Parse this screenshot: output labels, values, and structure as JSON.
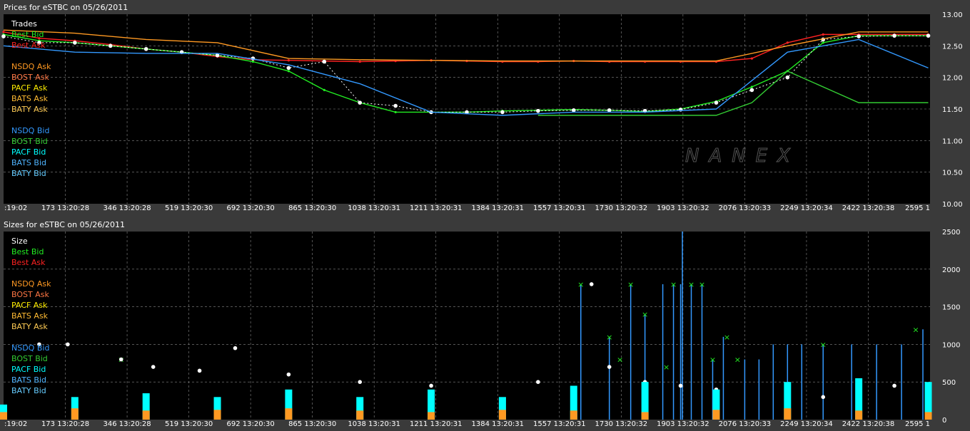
{
  "colors": {
    "trades": "#ffffff",
    "best_bid": "#22ee22",
    "best_ask": "#ff2222",
    "nsdq_ask": "#ff9922",
    "bost_ask": "#ff7744",
    "pacf_ask": "#ffee00",
    "bats_ask": "#ffbb33",
    "baty_ask": "#ffcc55",
    "nsdq_bid": "#3399ff",
    "bost_bid": "#33cc33",
    "pacf_bid": "#00ffff",
    "bats_bid": "#4fb4ff",
    "baty_bid": "#66ccff",
    "grid": "#888888",
    "plot_bg": "#000000",
    "frame_bg": "#3a3a3a"
  },
  "chart_data": [
    {
      "type": "line",
      "title": "Prices for  eSTBC  on  05/26/2011",
      "watermark": "NANEX",
      "ylim": [
        10.0,
        13.0
      ],
      "y_ticks": [
        "13.00",
        "12.50",
        "12.00",
        "11.50",
        "11.00",
        "10.50",
        "10.00"
      ],
      "x_tick_labels": [
        ":19:02",
        "173 13:20:28",
        "346 13:20:28",
        "519 13:20:30",
        "692 13:20:30",
        "865 13:20:30",
        "1038 13:20:31",
        "1211 13:20:31",
        "1384 13:20:31",
        "1557 13:20:31",
        "1730 13:20:32",
        "1903 13:20:32",
        "2076 13:20:33",
        "2249 13:20:34",
        "2422 13:20:38",
        "2595 1"
      ],
      "xlim": [
        0,
        2600
      ],
      "legend_position": "top-left",
      "legend": [
        {
          "label": "Trades",
          "color_key": "trades"
        },
        {
          "label": "Best Bid",
          "color_key": "best_bid"
        },
        {
          "label": "Best Ask",
          "color_key": "best_ask"
        },
        {
          "label": "NSDQ Ask",
          "color_key": "nsdq_ask"
        },
        {
          "label": "BOST Ask",
          "color_key": "bost_ask"
        },
        {
          "label": "PACF Ask",
          "color_key": "pacf_ask"
        },
        {
          "label": "BATS Ask",
          "color_key": "bats_ask"
        },
        {
          "label": "BATY Ask",
          "color_key": "baty_ask"
        },
        {
          "label": "NSDQ Bid",
          "color_key": "nsdq_bid"
        },
        {
          "label": "BOST Bid",
          "color_key": "bost_bid"
        },
        {
          "label": "PACF Bid",
          "color_key": "pacf_bid"
        },
        {
          "label": "BATS Bid",
          "color_key": "bats_bid"
        },
        {
          "label": "BATY Bid",
          "color_key": "baty_bid"
        }
      ],
      "series": [
        {
          "name": "Best Ask",
          "color_key": "best_ask",
          "x": [
            0,
            100,
            200,
            300,
            400,
            500,
            600,
            700,
            800,
            900,
            1000,
            1100,
            1200,
            1300,
            1400,
            1500,
            1600,
            1700,
            1800,
            1900,
            2000,
            2100,
            2200,
            2300,
            2400,
            2500,
            2595
          ],
          "y": [
            12.72,
            12.62,
            12.58,
            12.52,
            12.45,
            12.4,
            12.33,
            12.28,
            12.27,
            12.26,
            12.25,
            12.26,
            12.27,
            12.26,
            12.25,
            12.25,
            12.26,
            12.25,
            12.25,
            12.25,
            12.25,
            12.3,
            12.55,
            12.68,
            12.68,
            12.68,
            12.68
          ]
        },
        {
          "name": "Best Bid",
          "color_key": "best_bid",
          "x": [
            0,
            100,
            200,
            300,
            400,
            500,
            600,
            700,
            800,
            900,
            1000,
            1100,
            1200,
            1300,
            1400,
            1500,
            1600,
            1700,
            1800,
            1900,
            2000,
            2100,
            2200,
            2300,
            2400,
            2500,
            2595
          ],
          "y": [
            12.68,
            12.58,
            12.55,
            12.5,
            12.45,
            12.4,
            12.35,
            12.25,
            12.1,
            11.8,
            11.6,
            11.45,
            11.45,
            11.45,
            11.47,
            11.48,
            11.49,
            11.48,
            11.46,
            11.5,
            11.62,
            11.85,
            12.1,
            12.55,
            12.66,
            12.66,
            12.66
          ]
        },
        {
          "name": "Trades",
          "color_key": "trades",
          "x": [
            0,
            100,
            200,
            300,
            400,
            500,
            600,
            700,
            800,
            900,
            1000,
            1100,
            1200,
            1300,
            1400,
            1500,
            1600,
            1700,
            1800,
            1900,
            2000,
            2100,
            2200,
            2300,
            2400,
            2500,
            2595
          ],
          "y": [
            12.65,
            12.55,
            12.55,
            12.5,
            12.45,
            12.4,
            12.35,
            12.3,
            12.15,
            12.25,
            11.6,
            11.55,
            11.45,
            11.45,
            11.45,
            11.47,
            11.48,
            11.48,
            11.47,
            11.49,
            11.6,
            11.8,
            12.0,
            12.6,
            12.65,
            12.66,
            12.66
          ]
        },
        {
          "name": "NSDQ Bid",
          "color_key": "nsdq_bid",
          "x": [
            0,
            200,
            400,
            600,
            800,
            1000,
            1200,
            1400,
            1600,
            1800,
            2000,
            2200,
            2400,
            2595
          ],
          "y": [
            12.5,
            12.4,
            12.38,
            12.38,
            12.2,
            11.9,
            11.45,
            11.4,
            11.45,
            11.45,
            11.5,
            12.4,
            12.6,
            12.15
          ]
        },
        {
          "name": "NSDQ Ask",
          "color_key": "nsdq_ask",
          "x": [
            0,
            200,
            400,
            600,
            800,
            1000,
            1200,
            1400,
            1600,
            1800,
            2000,
            2200,
            2400,
            2595
          ],
          "y": [
            12.75,
            12.7,
            12.6,
            12.55,
            12.3,
            12.28,
            12.27,
            12.26,
            12.26,
            12.26,
            12.26,
            12.5,
            12.72,
            12.72
          ]
        },
        {
          "name": "BOST Bid",
          "color_key": "bost_bid",
          "x": [
            1500,
            1700,
            2000,
            2100,
            2200,
            2400,
            2595
          ],
          "y": [
            11.4,
            11.4,
            11.4,
            11.6,
            12.1,
            11.6,
            11.6
          ]
        }
      ]
    },
    {
      "type": "bar",
      "title": "Sizes for  eSTBC  on  05/26/2011",
      "ylim": [
        0,
        2500
      ],
      "y_ticks": [
        "2500",
        "2000",
        "1500",
        "1000",
        "500",
        "0"
      ],
      "x_tick_labels": [
        ":19:02",
        "173 13:20:28",
        "346 13:20:28",
        "519 13:20:30",
        "692 13:20:30",
        "865 13:20:30",
        "1038 13:20:31",
        "1211 13:20:31",
        "1384 13:20:31",
        "1557 13:20:31",
        "1730 13:20:32",
        "1903 13:20:32",
        "2076 13:20:33",
        "2249 13:20:34",
        "2422 13:20:38",
        "2595 1"
      ],
      "xlim": [
        0,
        2600
      ],
      "legend_position": "top-left",
      "legend": [
        {
          "label": "Size",
          "color_key": "trades"
        },
        {
          "label": "Best Bid",
          "color_key": "best_bid"
        },
        {
          "label": "Best Ask",
          "color_key": "best_ask"
        },
        {
          "label": "NSDQ Ask",
          "color_key": "nsdq_ask"
        },
        {
          "label": "BOST Ask",
          "color_key": "bost_ask"
        },
        {
          "label": "PACF Ask",
          "color_key": "pacf_ask"
        },
        {
          "label": "BATS Ask",
          "color_key": "bats_ask"
        },
        {
          "label": "BATY Ask",
          "color_key": "baty_ask"
        },
        {
          "label": "NSDQ Bid",
          "color_key": "nsdq_bid"
        },
        {
          "label": "BOST Bid",
          "color_key": "bost_bid"
        },
        {
          "label": "PACF Bid",
          "color_key": "pacf_bid"
        },
        {
          "label": "BATS Bid",
          "color_key": "bats_bid"
        },
        {
          "label": "BATY Bid",
          "color_key": "baty_bid"
        }
      ],
      "series": [
        {
          "name": "NSDQ Bid",
          "color_key": "nsdq_bid",
          "x": [
            1620,
            1700,
            1760,
            1800,
            1850,
            1880,
            1900,
            1905,
            1930,
            1960,
            1990,
            2020,
            2080,
            2120,
            2160,
            2200,
            2240,
            2300,
            2380,
            2450,
            2520,
            2580
          ],
          "y": [
            1800,
            1100,
            1800,
            1400,
            1800,
            1800,
            1800,
            2500,
            1800,
            1800,
            800,
            1100,
            800,
            800,
            1000,
            1000,
            1000,
            1000,
            1000,
            1000,
            1000,
            1200
          ]
        },
        {
          "name": "Best Bid",
          "color_key": "best_bid",
          "x": [
            330,
            1620,
            1700,
            1730,
            1760,
            1800,
            1860,
            1880,
            1930,
            1960,
            1990,
            2030,
            2060,
            2300,
            2560
          ],
          "y": [
            800,
            1800,
            1100,
            800,
            1800,
            1400,
            700,
            1800,
            1800,
            1800,
            800,
            1100,
            800,
            1000,
            1200
          ]
        },
        {
          "name": "Trades",
          "color_key": "trades",
          "x": [
            100,
            180,
            330,
            420,
            550,
            650,
            800,
            1000,
            1200,
            1500,
            1650,
            1700,
            1800,
            1900,
            2000,
            2300,
            2500
          ],
          "y": [
            1000,
            1000,
            800,
            700,
            650,
            950,
            600,
            500,
            450,
            500,
            1800,
            700,
            500,
            450,
            400,
            300,
            450
          ]
        },
        {
          "name": "PACF Bid",
          "color_key": "pacf_bid",
          "x": [
            0,
            200,
            400,
            600,
            800,
            1000,
            1200,
            1400,
            1600,
            1800,
            2000,
            2200,
            2400,
            2595
          ],
          "y": [
            200,
            300,
            350,
            300,
            400,
            300,
            400,
            300,
            450,
            500,
            400,
            500,
            550,
            500
          ]
        },
        {
          "name": "NSDQ Ask",
          "color_key": "nsdq_ask",
          "x": [
            0,
            200,
            400,
            600,
            800,
            1000,
            1200,
            1400,
            1600,
            1800,
            2000,
            2200,
            2400,
            2595
          ],
          "y": [
            100,
            150,
            120,
            130,
            150,
            120,
            100,
            130,
            120,
            100,
            130,
            150,
            120,
            100
          ]
        }
      ]
    }
  ]
}
